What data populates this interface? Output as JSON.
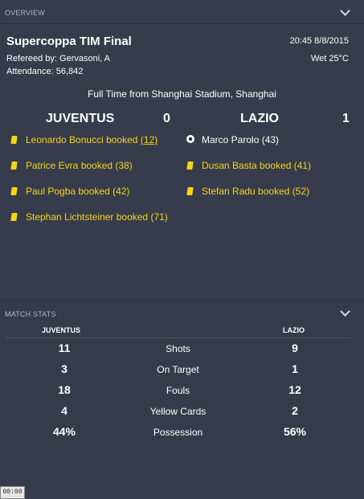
{
  "overview": {
    "header": "OVERVIEW",
    "competition": "Supercoppa TIM Final",
    "referee": "Refereed by: Gervasoni, A",
    "attendance": "Attendance: 56,842",
    "datetime": "20:45 8/8/2015",
    "weather": "Wet 25°C",
    "result_line": "Full Time from Shanghai Stadium, Shanghai",
    "home": {
      "name": "JUVENTUS",
      "score": "0"
    },
    "away": {
      "name": "LAZIO",
      "score": "1"
    },
    "home_events": [
      {
        "icon": "yellow-card-icon",
        "text": "Leonardo Bonucci booked",
        "minute": "(12)"
      },
      {
        "icon": "yellow-card-icon",
        "text": "Patrice Evra booked (38)"
      },
      {
        "icon": "yellow-card-icon",
        "text": "Paul Pogba booked (42)"
      },
      {
        "icon": "yellow-card-icon",
        "text": "Stephan Lichtsteiner booked (71)"
      }
    ],
    "away_events": [
      {
        "icon": "goal-ball-icon",
        "text": "Marco Parolo (43)"
      },
      {
        "icon": "yellow-card-icon",
        "text": "Dusan Basta booked (41)"
      },
      {
        "icon": "yellow-card-icon",
        "text": "Stefan Radu booked (52)"
      }
    ]
  },
  "match_stats": {
    "header": "MATCH STATS",
    "home_team": "JUVENTUS",
    "away_team": "LAZIO",
    "rows": [
      {
        "label": "Shots",
        "home": "11",
        "away": "9"
      },
      {
        "label": "On Target",
        "home": "3",
        "away": "1"
      },
      {
        "label": "Fouls",
        "home": "18",
        "away": "12"
      },
      {
        "label": "Yellow Cards",
        "home": "4",
        "away": "2"
      },
      {
        "label": "Possession",
        "home": "44%",
        "away": "56%"
      }
    ]
  },
  "clock_text": "00:00",
  "colors": {
    "background": "#313746",
    "panel": "#363c4b",
    "booking_text": "#f5d31f",
    "yellow_card": "#f7d416"
  }
}
